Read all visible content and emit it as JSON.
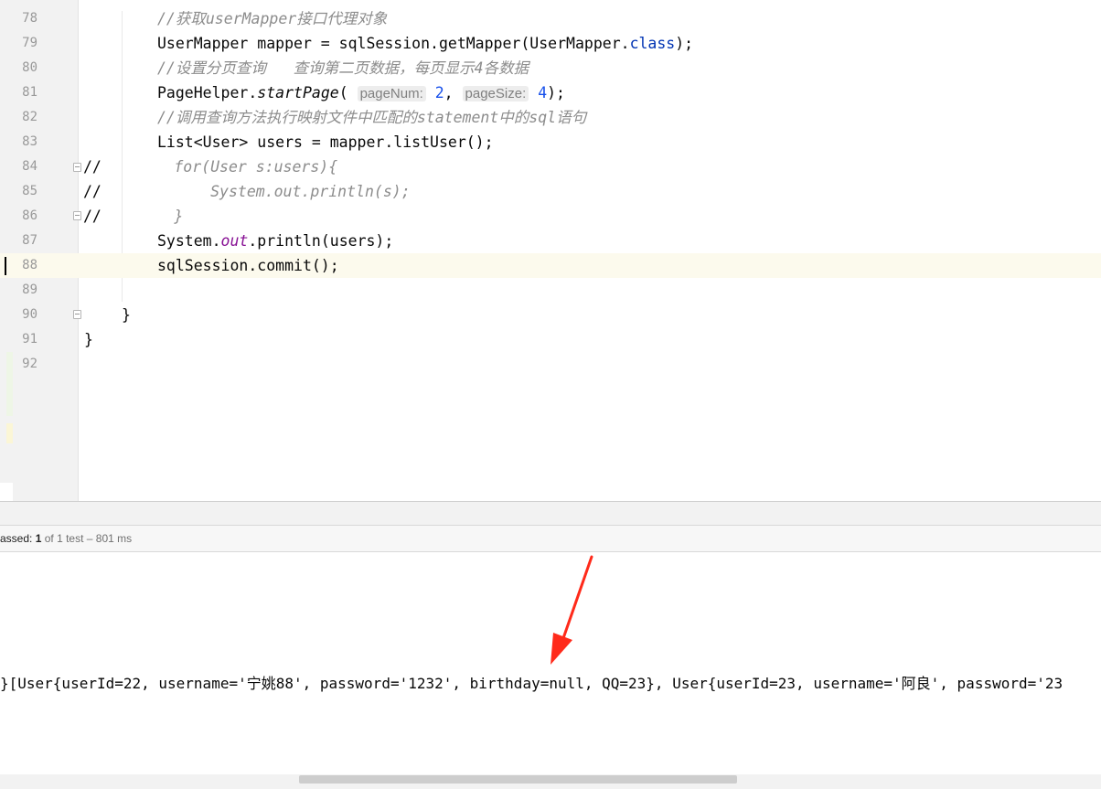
{
  "editor": {
    "lines": [
      {
        "n": "78",
        "parts": [
          {
            "t": "//获取userMapper接口代理对象",
            "c": "cmt"
          }
        ]
      },
      {
        "n": "79",
        "parts": [
          {
            "t": "UserMapper mapper = sqlSession.getMapper(UserMapper.",
            "c": ""
          },
          {
            "t": "class",
            "c": "kw"
          },
          {
            "t": ");",
            "c": ""
          }
        ]
      },
      {
        "n": "80",
        "parts": [
          {
            "t": "//设置分页查询   查询第二页数据，每页显示4各数据",
            "c": "cmt"
          }
        ]
      },
      {
        "n": "81",
        "parts": [
          {
            "t": "PageHelper.",
            "c": ""
          },
          {
            "t": "startPage",
            "c": "ital"
          },
          {
            "t": "( ",
            "c": ""
          },
          {
            "t": "pageNum:",
            "c": "hint"
          },
          {
            "t": " ",
            "c": ""
          },
          {
            "t": "2",
            "c": "num"
          },
          {
            "t": ", ",
            "c": ""
          },
          {
            "t": "pageSize:",
            "c": "hint"
          },
          {
            "t": " ",
            "c": ""
          },
          {
            "t": "4",
            "c": "num"
          },
          {
            "t": ");",
            "c": ""
          }
        ]
      },
      {
        "n": "82",
        "parts": [
          {
            "t": "//调用查询方法执行映射文件中匹配的statement中的sql语句",
            "c": "cmt"
          }
        ]
      },
      {
        "n": "83",
        "parts": [
          {
            "t": "List<User> users = mapper.listUser();",
            "c": ""
          }
        ]
      },
      {
        "n": "84",
        "parts": [
          {
            "t": "//",
            "c": ""
          },
          {
            "t": "        for(User s:users){",
            "c": "cmt"
          }
        ]
      },
      {
        "n": "85",
        "parts": [
          {
            "t": "//",
            "c": ""
          },
          {
            "t": "            System.out.println(s);",
            "c": "cmt"
          }
        ]
      },
      {
        "n": "86",
        "parts": [
          {
            "t": "//",
            "c": ""
          },
          {
            "t": "        }",
            "c": "cmt"
          }
        ]
      },
      {
        "n": "87",
        "parts": [
          {
            "t": "System.",
            "c": ""
          },
          {
            "t": "out",
            "c": "fld"
          },
          {
            "t": ".println(users);",
            "c": ""
          }
        ]
      },
      {
        "n": "88",
        "parts": [
          {
            "t": "sqlSession.commit();",
            "c": ""
          }
        ]
      },
      {
        "n": "89",
        "parts": []
      },
      {
        "n": "90",
        "parts": [
          {
            "t": "}",
            "c": ""
          }
        ]
      },
      {
        "n": "91",
        "parts": [
          {
            "t": "}",
            "c": ""
          }
        ]
      },
      {
        "n": "92",
        "parts": []
      }
    ]
  },
  "status": {
    "passed_label": "assed:",
    "passed_count": "1",
    "of_label": "of 1 test",
    "duration": "– 801 ms"
  },
  "console": {
    "output": "}[User{userId=22, username='宁姚88', password='1232', birthday=null, QQ=23}, User{userId=23, username='阿良', password='23"
  },
  "colors": {
    "comment": "#8c8c8c",
    "keyword": "#0033b3",
    "number": "#1750eb",
    "field": "#871094",
    "current_line": "#fcfaed",
    "arrow": "#ff2a1a"
  }
}
